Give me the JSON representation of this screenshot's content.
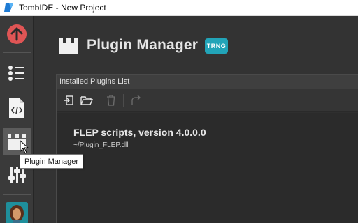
{
  "window": {
    "title": "TombIDE - New Project"
  },
  "sidebar": {
    "items": [
      {
        "name": "up-arrow",
        "color": "#e05555"
      },
      {
        "name": "levels"
      },
      {
        "name": "script"
      },
      {
        "name": "plugins"
      },
      {
        "name": "misc"
      },
      {
        "name": "avatar"
      }
    ],
    "tooltip": "Plugin Manager"
  },
  "main": {
    "title": "Plugin Manager",
    "badge": "TRNG",
    "badge_color": "#22a4b8"
  },
  "panel": {
    "title": "Installed Plugins List",
    "toolbar_icons": [
      "import-icon",
      "open-folder-icon",
      "delete-icon",
      "refresh-icon"
    ],
    "plugin": {
      "name": "FLEP scripts, version 4.0.0.0",
      "path": "~/Plugin_FLEP.dll"
    }
  }
}
